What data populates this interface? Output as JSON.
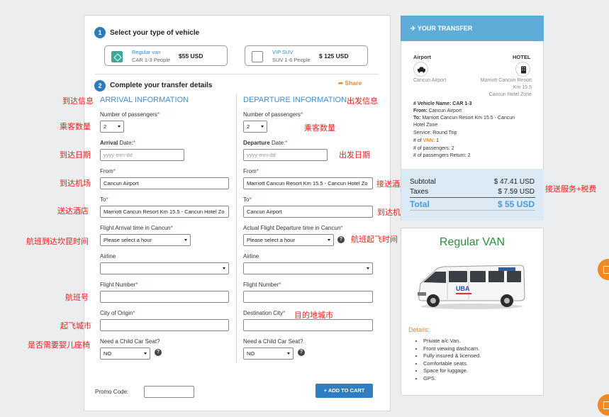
{
  "step1": {
    "number": "1",
    "title": "Select your type of vehicle"
  },
  "vehicles": [
    {
      "name": "Regular van",
      "sub": "CAR 1-3 People",
      "price": "$55 USD",
      "selected": true
    },
    {
      "name": "VIP SUV",
      "sub": "SUV 1-6 People",
      "price": "$ 125 USD",
      "selected": false
    }
  ],
  "step2": {
    "number": "2",
    "title": "Complete your transfer details",
    "share": "Share"
  },
  "arrival": {
    "heading": "ARRIVAL INFORMATION",
    "passengers_label": "Number of passengers",
    "passengers_value": "2",
    "date_label_bold": "Arrival",
    "date_label_rest": " Date:",
    "date_placeholder": "yyyy-mm-dd",
    "from_label": "From",
    "from_value": "Cancun Airport",
    "to_label": "To",
    "to_value": "Marriott Cancun Resort Km 15.5 - Cancun Hotel Zo",
    "flight_time_label": "Flight Arrival time in Cancun",
    "flight_time_value": "Please select a hour",
    "airline_label": "Airline",
    "airline_value": "",
    "flight_number_label": "Flight Number",
    "flight_number_value": "",
    "city_label": "City of Origin",
    "city_value": "",
    "seat_label": "Need a Child Car Seat?",
    "seat_value": "NO"
  },
  "departure": {
    "heading": "DEPARTURE INFORMATION",
    "passengers_label": "Number of passengers",
    "passengers_value": "2",
    "date_label_bold": "Departure",
    "date_label_rest": " Date:",
    "date_placeholder": "yyyy-mm-dd",
    "from_label": "From",
    "from_value": "Marriott Cancun Resort Km 15.5 - Cancun Hotel Zo",
    "to_label": "To",
    "to_value": "Cancun Airport",
    "flight_time_label": "Actual Flight Departure time in Cancun",
    "flight_time_value": "Please select a hour",
    "airline_label": "Airline",
    "airline_value": "",
    "flight_number_label": "Flight Number",
    "flight_number_value": "",
    "city_label": "Destination City",
    "city_value": "",
    "seat_label": "Need a Child Car Seat?",
    "seat_value": "NO"
  },
  "required_mark": "*",
  "help_glyph": "?",
  "promo": {
    "label": "Promo Code:",
    "value": ""
  },
  "add_to_cart": "+ ADD TO CART",
  "annotations": {
    "arrival_info": "到达信息",
    "departure_info": "出发信息",
    "passengers_left": "乘客数量",
    "passengers_right": "乘客数量",
    "arrival_date": "到达日期",
    "departure_date": "出发日期",
    "arrival_airport": "到达机场",
    "pickup_hotel": "接送酒店",
    "dropoff_hotel": "送达酒店",
    "arrival_airport_right": "到达机场",
    "arrival_flight_time": "航班到达坎昆时间",
    "departure_flight_time": "航班起飞时间",
    "flight_number": "航班号",
    "destination_city": "目的地城市",
    "origin_city": "起飞城市",
    "child_seat": "是否需要婴儿座椅",
    "service_tax": "接送服务+税费"
  },
  "transfer": {
    "header": "YOUR TRANSFER",
    "from_title": "Airport",
    "from_name": "Cancun Airport",
    "to_title": "HOTEL",
    "to_name_lines": [
      "Marriott Cancun Resort",
      "Km 15.5",
      "Cancun Hotel Zone"
    ],
    "vehicle_prefix": "# Vehicle Name: ",
    "vehicle_value": "CAR 1-3",
    "from_prefix": "From: ",
    "from_value": "Cancun Airport",
    "to_prefix": "To: ",
    "to_value_lines": [
      "Marriott Cancun Resort Km 15.5 - Cancun",
      "Hotel Zone"
    ],
    "service_line": "Service: Round Trip",
    "van_prefix": "# of ",
    "van_word": "VAN:",
    "van_value": " 1",
    "passengers_line": "# of passengers: 2",
    "passengers_return_line": "# of passengers Return: 2",
    "subtotal_label": "Subtotal",
    "subtotal_value": "$ 47.41 USD",
    "taxes_label": "Taxes",
    "taxes_value": "$ 7.59 USD",
    "total_label": "Total",
    "total_value": "$ 55 USD"
  },
  "van_card": {
    "title": "Regular VAN",
    "van_logo_text": "UBA",
    "details_label": "Details:",
    "details": [
      "Private a/c Van.",
      "Front viewing dashcam.",
      "Fully insured & licensed.",
      "Comfortable seats.",
      "Space for luggage.",
      "GPS."
    ]
  },
  "colors": {
    "accent_blue": "#3f8fd2",
    "header_blue": "#5dadd8",
    "cart_blue": "#2f7dc2",
    "van_green": "#2e8b3e",
    "annotation_red": "#e8231d",
    "share_orange": "#f08a24"
  }
}
